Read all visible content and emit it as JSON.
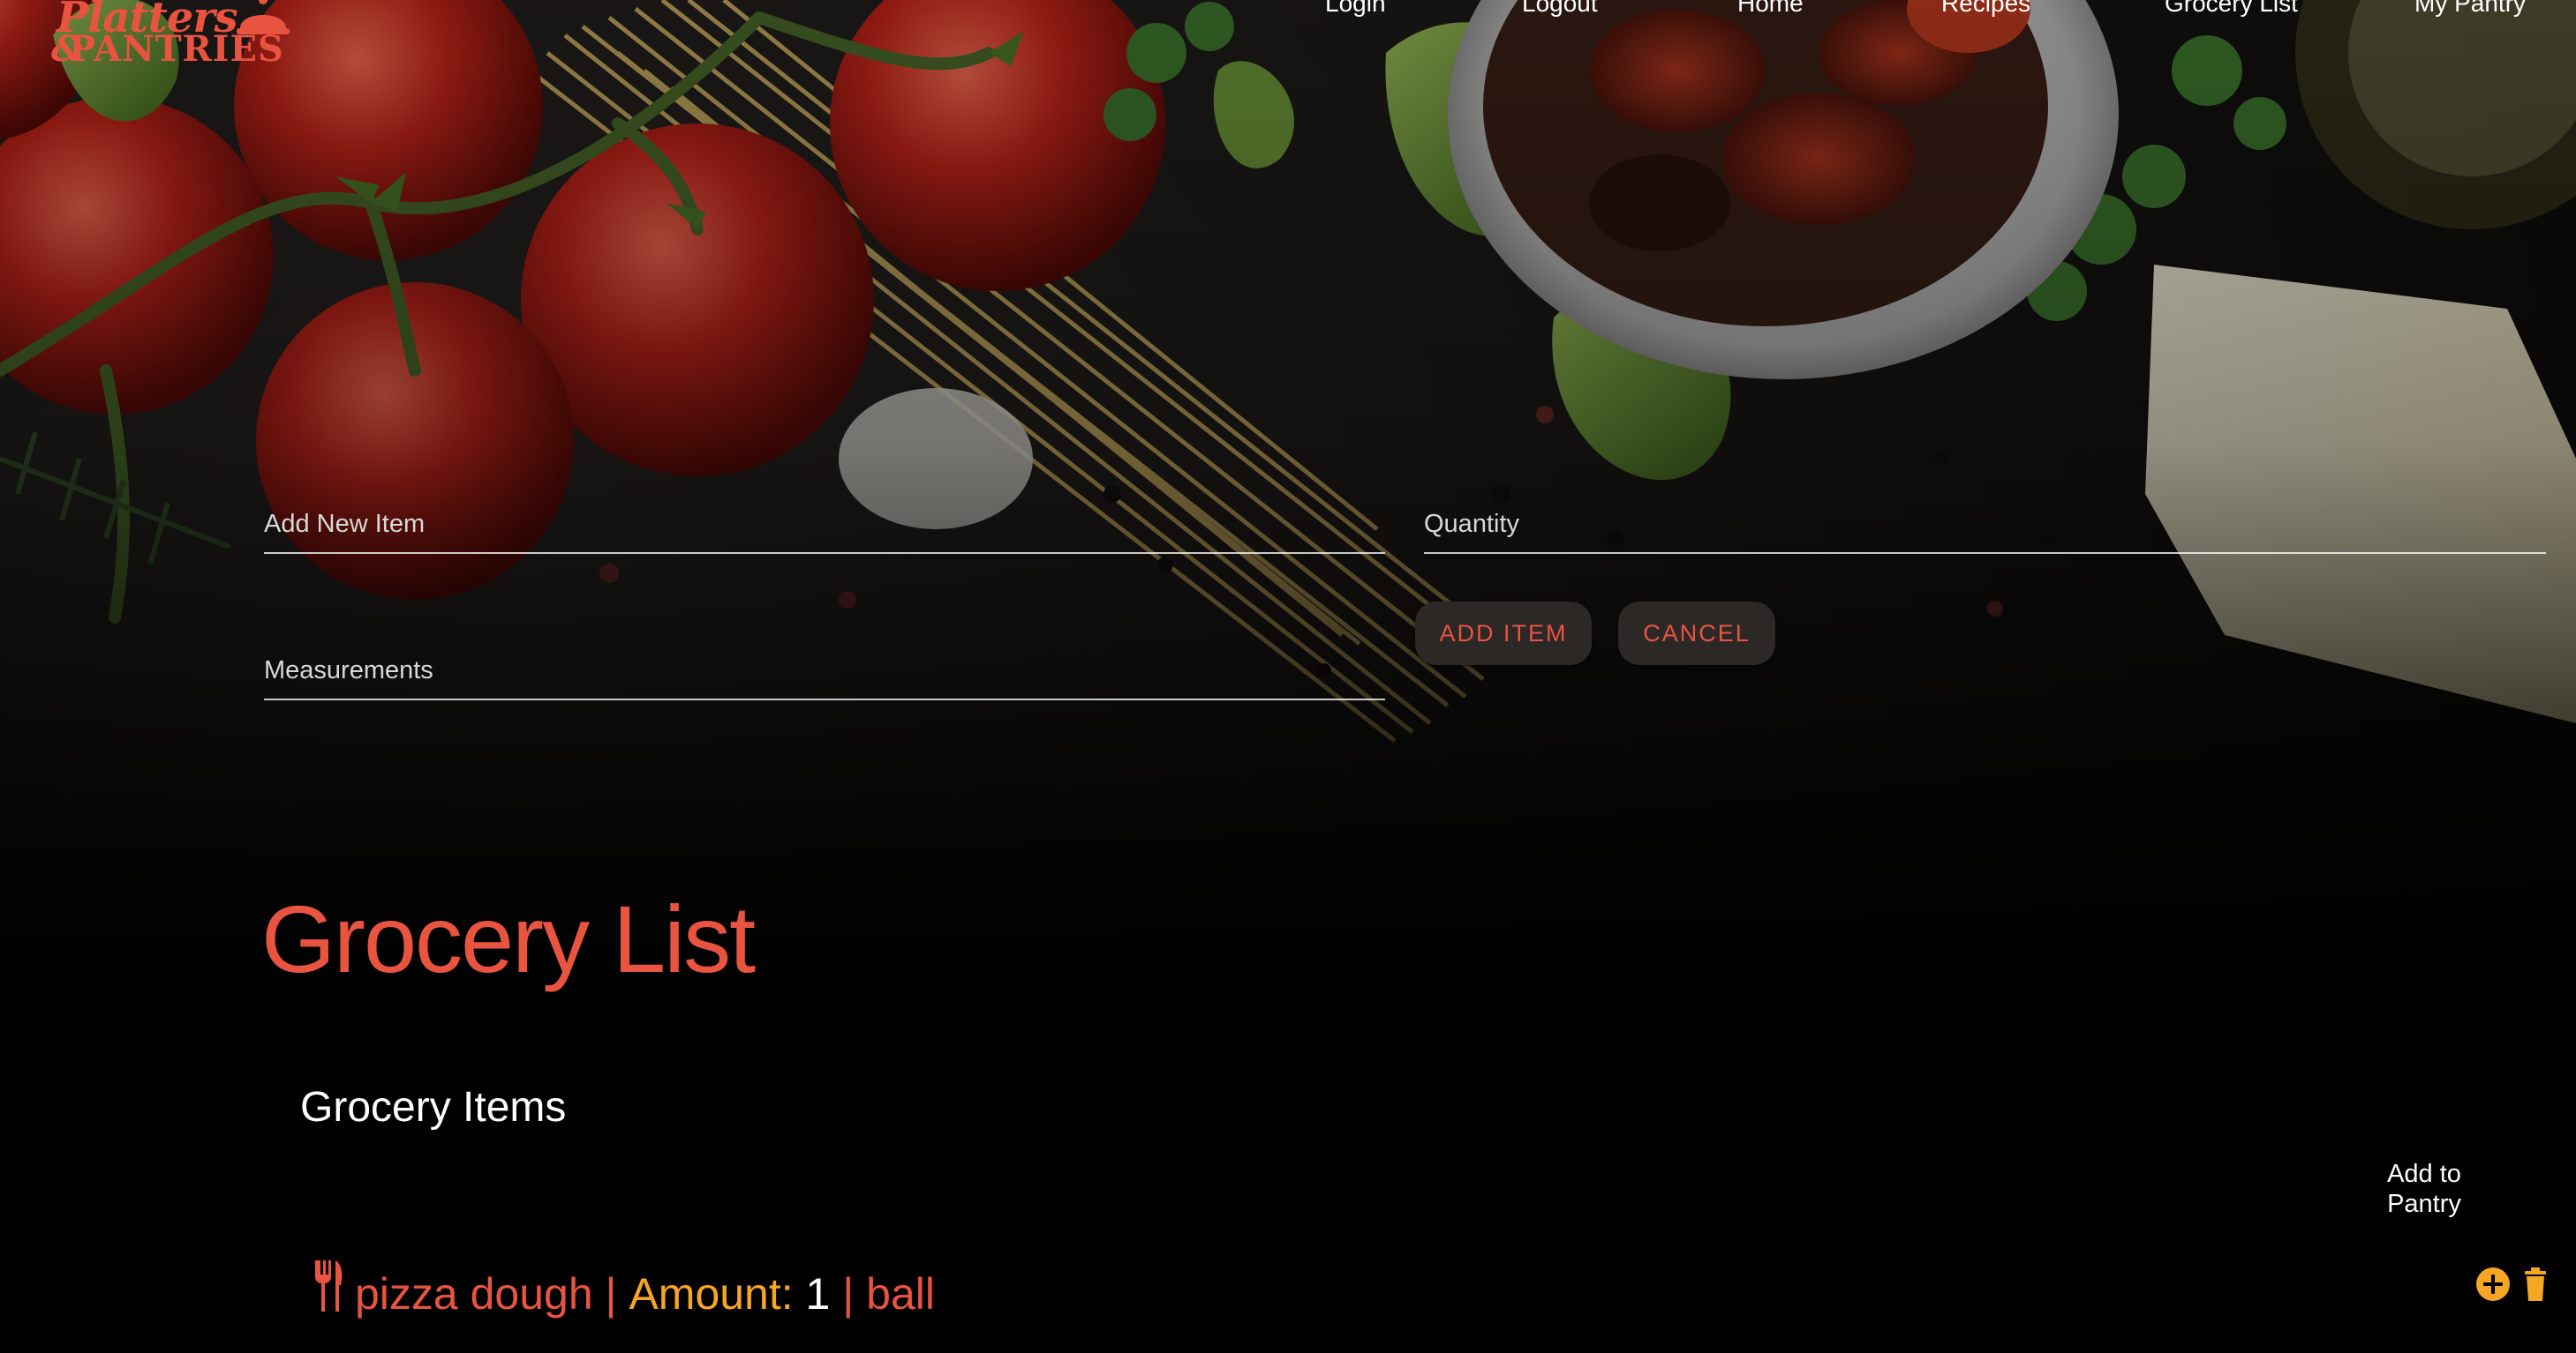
{
  "brand": {
    "logo_line1": "Platters",
    "logo_amp": "&",
    "logo_line2": "PANTRIES"
  },
  "nav": {
    "items": [
      "Login",
      "Logout",
      "Home",
      "Recipes",
      "Grocery List",
      "My Pantry"
    ]
  },
  "form": {
    "item_placeholder": "Add New Item",
    "quantity_placeholder": "Quantity",
    "measurements_placeholder": "Measurements",
    "add_button": "ADD ITEM",
    "cancel_button": "CANCEL"
  },
  "page": {
    "title": "Grocery List"
  },
  "grocery": {
    "section_title": "Grocery Items",
    "add_to_pantry_label": "Add to Pantry",
    "items": [
      {
        "name": "pizza dough",
        "sep1": " | ",
        "amount_label": "Amount: ",
        "amount": "1",
        "sep2": " | ",
        "unit": "ball"
      }
    ]
  },
  "icons": {
    "item_icon": "fork-knife-icon",
    "add_icon": "plus-circle-icon",
    "delete_icon": "trash-icon"
  },
  "colors": {
    "accent": "#e8543f",
    "highlight": "#f5a623",
    "background": "#000000",
    "button_bg": "#2b2826"
  }
}
